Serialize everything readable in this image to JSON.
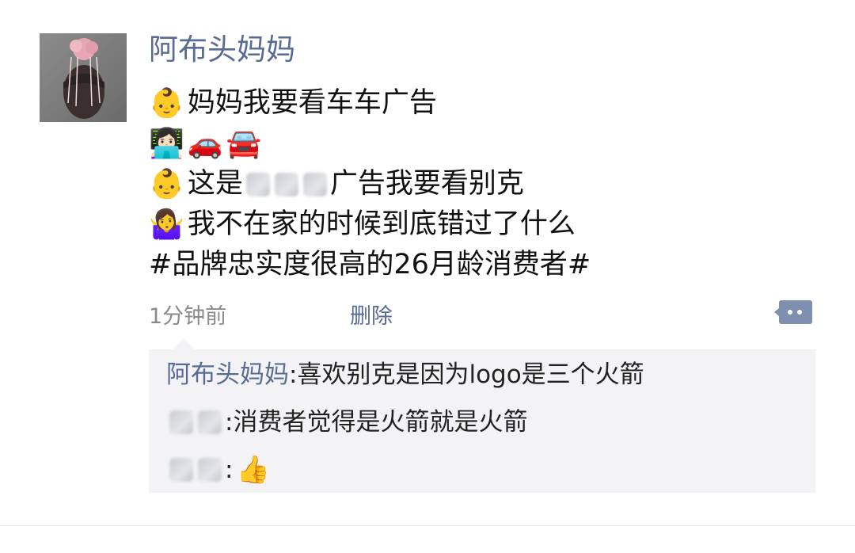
{
  "post": {
    "author": "阿布头妈妈",
    "lines": [
      {
        "emoji": "👶",
        "text": "妈妈我要看车车广告"
      },
      {
        "emojis": [
          "👩🏻‍💻",
          "🚗",
          "🚘"
        ]
      },
      {
        "emoji": "👶",
        "prefix": "这是",
        "suffix": "广告我要看别克"
      },
      {
        "emoji": "🤷‍♀️",
        "text": "我不在家的时候到底错过了什么"
      },
      {
        "text": "#品牌忠实度很高的26月龄消费者#"
      }
    ],
    "timestamp": "1分钟前",
    "delete_label": "删除",
    "comment_icon": "comment-bubble-icon"
  },
  "comments": [
    {
      "author": "阿布头妈妈",
      "separator": ": ",
      "text": "喜欢别克是因为logo是三个火箭"
    },
    {
      "author_blurred": true,
      "separator": ": ",
      "text": "消费者觉得是火箭就是火箭"
    },
    {
      "author_blurred": true,
      "separator": ": ",
      "emoji": "👍"
    }
  ],
  "colors": {
    "link": "#576b95",
    "meta": "#8a8a8a",
    "comment_bg": "#f3f3f5"
  }
}
